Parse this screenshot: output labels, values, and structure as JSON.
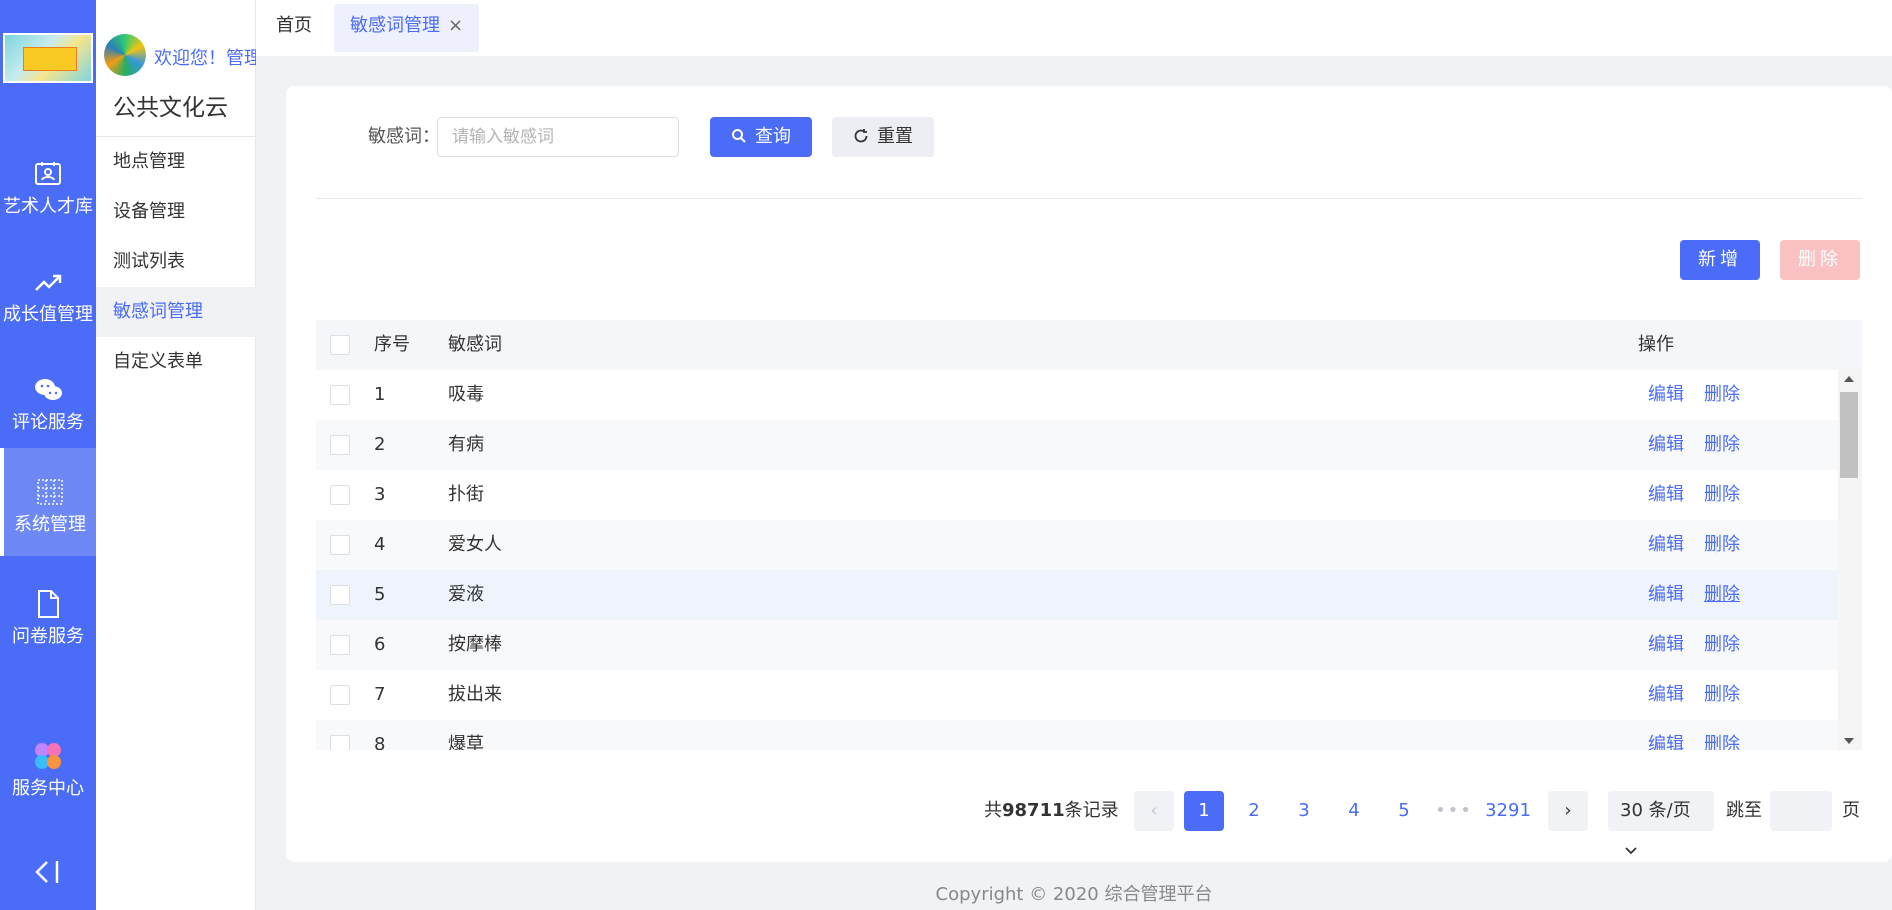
{
  "sidebar": {
    "items": [
      {
        "label": "艺术人才库",
        "icon": "talent-icon"
      },
      {
        "label": "成长值管理",
        "icon": "trend-up-icon"
      },
      {
        "label": "评论服务",
        "icon": "wechat-icon"
      },
      {
        "label": "系统管理",
        "icon": "grid-icon"
      },
      {
        "label": "问卷服务",
        "icon": "document-icon"
      }
    ],
    "service_center": "服务中心",
    "collapse_icon": "collapse-icon"
  },
  "submenu": {
    "welcome": "欢迎您！管理员",
    "org_title": "公共文化云",
    "items": [
      "地点管理",
      "设备管理",
      "测试列表",
      "敏感词管理",
      "自定义表单"
    ]
  },
  "tabs": {
    "home": "首页",
    "current": "敏感词管理",
    "close": "×"
  },
  "filter": {
    "label": "敏感词：",
    "placeholder": "请输入敏感词",
    "query": "查询",
    "reset": "重置"
  },
  "actions": {
    "add": "新增",
    "delete": "删除"
  },
  "table": {
    "headers": {
      "index": "序号",
      "word": "敏感词",
      "op": "操作"
    },
    "edit": "编辑",
    "remove": "删除",
    "rows": [
      {
        "index": "1",
        "word": "吸毒"
      },
      {
        "index": "2",
        "word": "有病"
      },
      {
        "index": "3",
        "word": "扑街"
      },
      {
        "index": "4",
        "word": "爱女人"
      },
      {
        "index": "5",
        "word": "爱液"
      },
      {
        "index": "6",
        "word": "按摩棒"
      },
      {
        "index": "7",
        "word": "拔出来"
      },
      {
        "index": "8",
        "word": "爆草"
      }
    ]
  },
  "pagination": {
    "total_prefix": "共",
    "total": "98711",
    "total_suffix": "条记录",
    "prev": "‹",
    "next": "›",
    "pages": [
      "1",
      "2",
      "3",
      "4",
      "5"
    ],
    "dots": "•••",
    "last": "3291",
    "current": "1",
    "page_size": "30 条/页",
    "jump_prefix": "跳至",
    "jump_suffix": "页"
  },
  "footer": "Copyright © 2020 综合管理平台",
  "colors": {
    "primary": "#4a6cf7",
    "danger_light": "#f9c1c1"
  }
}
